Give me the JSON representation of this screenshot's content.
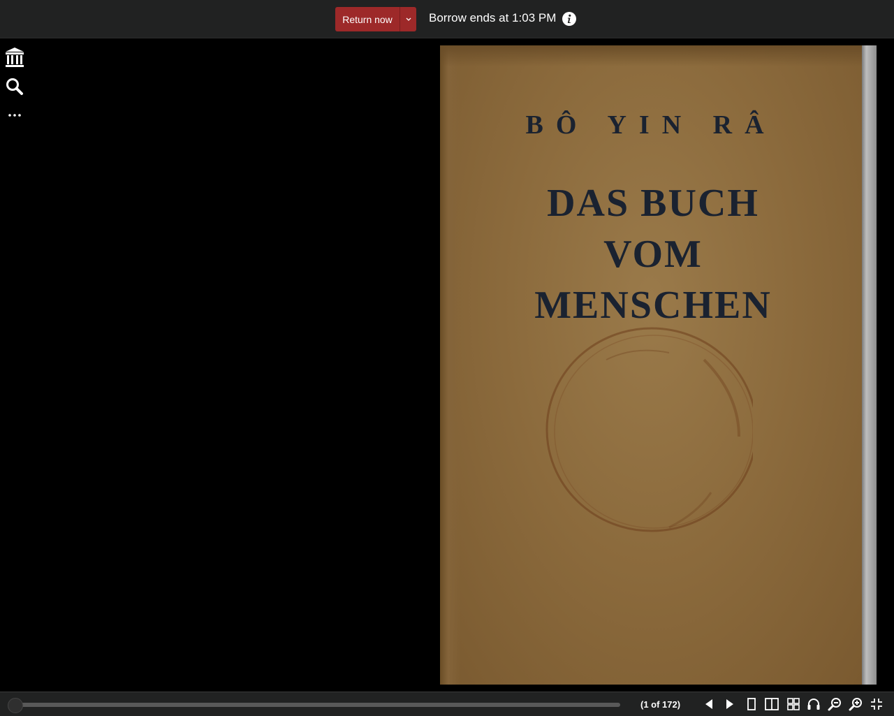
{
  "topbar": {
    "return_label": "Return now",
    "borrow_text": "Borrow ends at 1:03 PM"
  },
  "sidebar": {
    "icons": [
      "archive-icon",
      "search-icon",
      "more-icon"
    ]
  },
  "book": {
    "cover_author": "BÔ YIN RÂ",
    "cover_title_lines": [
      "DAS BUCH",
      "VOM",
      "MENSCHEN"
    ]
  },
  "bottombar": {
    "page_count": "(1 of 172)",
    "progress": 0.0
  },
  "colors": {
    "accent": "#9d2929",
    "bar": "#212222"
  }
}
